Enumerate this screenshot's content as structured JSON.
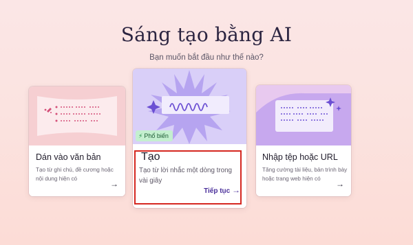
{
  "header": {
    "title": "Sáng tạo bằng AI",
    "subtitle": "Bạn muốn bắt đầu như thế nào?"
  },
  "cards": [
    {
      "title": "Dán vào văn bản",
      "description": "Tạo từ ghi chú, đề cương hoặc nội dung hiện có",
      "icon": "arrow-right-icon"
    },
    {
      "title": "Tạo",
      "description": "Tạo từ lời nhắc một dòng trong vài giây",
      "badge": "Phổ biến",
      "badge_icon": "lightning-icon",
      "action_label": "Tiếp tục",
      "icon": "arrow-right-icon"
    },
    {
      "title": "Nhập tệp hoặc URL",
      "description": "Tăng cường tài liệu, bản trình bày hoặc trang web hiện có",
      "icon": "arrow-right-icon"
    }
  ],
  "colors": {
    "accent": "#4a2f9a",
    "highlight_border": "#d5261f",
    "badge_bg": "#c4efcf"
  }
}
